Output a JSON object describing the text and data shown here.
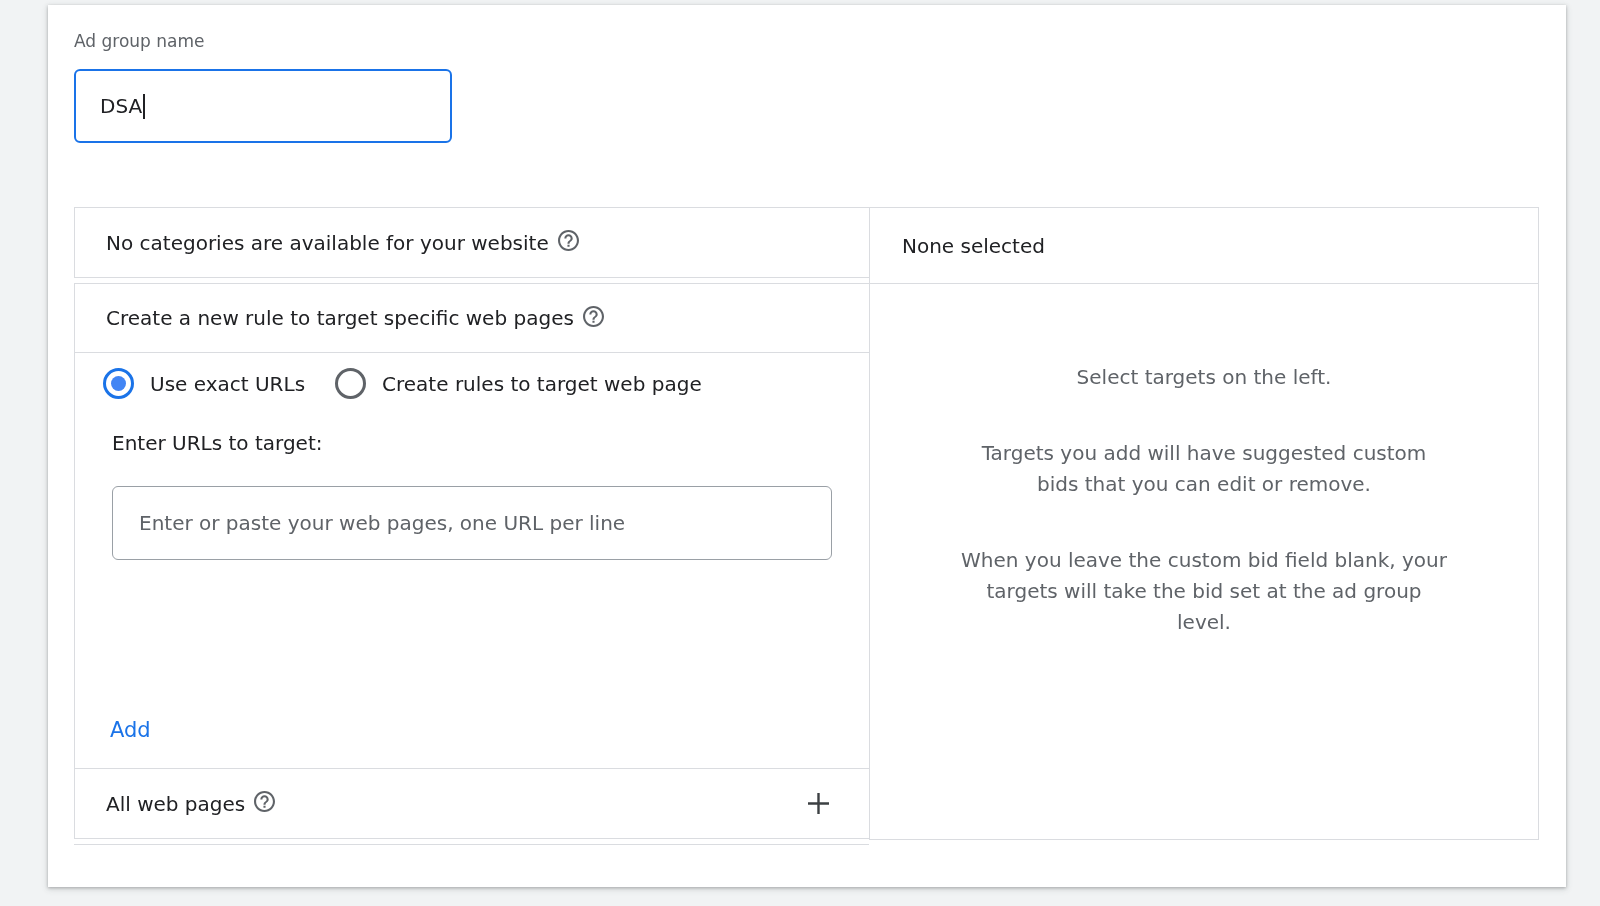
{
  "ad_group_name": {
    "label": "Ad group name",
    "value": "DSA",
    "focused": true
  },
  "categories_panel": {
    "title": "No categories are available for your website"
  },
  "rule_panel": {
    "title": "Create a new rule to target specific web pages",
    "options": [
      {
        "label": "Use exact URLs",
        "selected": true
      },
      {
        "label": "Create rules to target web page",
        "selected": false
      }
    ],
    "urls_label": "Enter URLs to target:",
    "urls_field": {
      "placeholder": "Enter or paste your web pages, one URL per line"
    },
    "add_link": "Add"
  },
  "all_pages_panel": {
    "title": "All web pages"
  },
  "selection_panel": {
    "title": "None selected",
    "messages": [
      "Select targets on the left.",
      "Targets you add will have suggested custom bids that you can edit or remove.",
      "When you leave the custom bid field blank, your targets will take the bid set at the ad group level."
    ]
  }
}
